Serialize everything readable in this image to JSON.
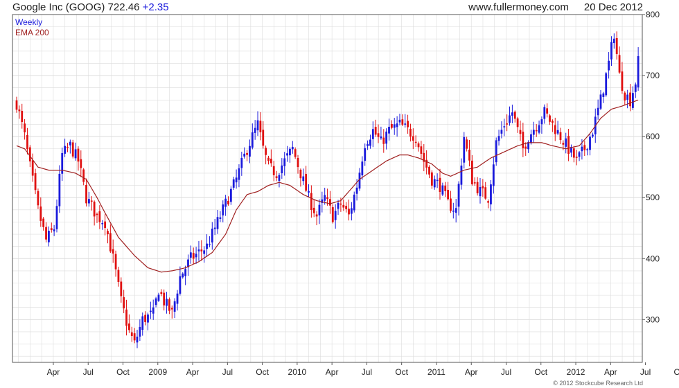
{
  "header": {
    "title": "Google Inc (GOOG) 722.46",
    "change": "+2.35",
    "website": "www.fullermoney.com",
    "date": "20 Dec 2012"
  },
  "legend": {
    "weekly": "Weekly",
    "ema": "EMA 200"
  },
  "copyright": "© 2012 Stockcube Research Ltd",
  "colors": {
    "up": "#1a1adc",
    "down": "#e01010",
    "ema": "#a02020",
    "grid": "#dcdcdc",
    "frame": "#555555"
  },
  "chart_data": {
    "type": "candlestick",
    "x_tick_labels": [
      "Apr",
      "Jul",
      "Oct",
      "2009",
      "Apr",
      "Jul",
      "Oct",
      "2010",
      "Apr",
      "Jul",
      "Oct",
      "2011",
      "Apr",
      "Jul",
      "Oct",
      "2012",
      "Apr",
      "Jul",
      "Oct"
    ],
    "y_tick_labels": [
      300,
      400,
      500,
      600,
      700,
      800
    ],
    "ylim": [
      230,
      800
    ],
    "grid": true,
    "legend_position": "top-left",
    "price_anchors": [
      [
        0,
        655
      ],
      [
        3,
        600
      ],
      [
        5,
        550
      ],
      [
        8,
        480
      ],
      [
        11,
        430
      ],
      [
        14,
        450
      ],
      [
        17,
        570
      ],
      [
        20,
        585
      ],
      [
        23,
        560
      ],
      [
        26,
        500
      ],
      [
        30,
        470
      ],
      [
        33,
        460
      ],
      [
        36,
        400
      ],
      [
        39,
        330
      ],
      [
        42,
        280
      ],
      [
        44,
        260
      ],
      [
        47,
        300
      ],
      [
        51,
        310
      ],
      [
        53,
        350
      ],
      [
        55,
        330
      ],
      [
        58,
        310
      ],
      [
        61,
        370
      ],
      [
        65,
        400
      ],
      [
        68,
        410
      ],
      [
        71,
        420
      ],
      [
        74,
        450
      ],
      [
        78,
        490
      ],
      [
        82,
        530
      ],
      [
        86,
        580
      ],
      [
        90,
        620
      ],
      [
        92,
        580
      ],
      [
        94,
        550
      ],
      [
        97,
        540
      ],
      [
        100,
        560
      ],
      [
        103,
        580
      ],
      [
        106,
        540
      ],
      [
        109,
        500
      ],
      [
        112,
        470
      ],
      [
        115,
        500
      ],
      [
        118,
        470
      ],
      [
        121,
        490
      ],
      [
        124,
        470
      ],
      [
        127,
        520
      ],
      [
        130,
        590
      ],
      [
        133,
        610
      ],
      [
        136,
        590
      ],
      [
        139,
        610
      ],
      [
        143,
        620
      ],
      [
        146,
        610
      ],
      [
        149,
        600
      ],
      [
        152,
        560
      ],
      [
        155,
        530
      ],
      [
        158,
        520
      ],
      [
        161,
        490
      ],
      [
        164,
        480
      ],
      [
        167,
        600
      ],
      [
        170,
        530
      ],
      [
        173,
        510
      ],
      [
        176,
        500
      ],
      [
        179,
        590
      ],
      [
        182,
        620
      ],
      [
        185,
        640
      ],
      [
        187,
        610
      ],
      [
        189,
        580
      ],
      [
        191,
        600
      ],
      [
        194,
        620
      ],
      [
        197,
        640
      ],
      [
        200,
        620
      ],
      [
        203,
        600
      ],
      [
        206,
        580
      ],
      [
        209,
        560
      ],
      [
        212,
        580
      ],
      [
        215,
        610
      ],
      [
        218,
        660
      ],
      [
        221,
        720
      ],
      [
        223,
        770
      ],
      [
        225,
        700
      ],
      [
        227,
        670
      ],
      [
        229,
        660
      ],
      [
        231,
        690
      ],
      [
        232,
        722.46
      ]
    ],
    "ema200_anchors": [
      [
        0,
        585
      ],
      [
        3,
        580
      ],
      [
        8,
        550
      ],
      [
        12,
        545
      ],
      [
        17,
        545
      ],
      [
        22,
        540
      ],
      [
        26,
        530
      ],
      [
        30,
        500
      ],
      [
        33,
        475
      ],
      [
        38,
        435
      ],
      [
        44,
        405
      ],
      [
        49,
        385
      ],
      [
        54,
        378
      ],
      [
        58,
        380
      ],
      [
        63,
        385
      ],
      [
        68,
        395
      ],
      [
        73,
        410
      ],
      [
        78,
        440
      ],
      [
        82,
        480
      ],
      [
        86,
        505
      ],
      [
        90,
        510
      ],
      [
        94,
        520
      ],
      [
        98,
        525
      ],
      [
        102,
        520
      ],
      [
        107,
        505
      ],
      [
        112,
        495
      ],
      [
        117,
        490
      ],
      [
        121,
        495
      ],
      [
        124,
        510
      ],
      [
        128,
        530
      ],
      [
        133,
        545
      ],
      [
        138,
        560
      ],
      [
        143,
        570
      ],
      [
        146,
        570
      ],
      [
        150,
        565
      ],
      [
        155,
        555
      ],
      [
        159,
        540
      ],
      [
        162,
        535
      ],
      [
        167,
        545
      ],
      [
        172,
        550
      ],
      [
        177,
        565
      ],
      [
        182,
        575
      ],
      [
        187,
        585
      ],
      [
        191,
        590
      ],
      [
        196,
        590
      ],
      [
        200,
        585
      ],
      [
        205,
        580
      ],
      [
        210,
        585
      ],
      [
        214,
        605
      ],
      [
        218,
        630
      ],
      [
        222,
        645
      ],
      [
        226,
        650
      ],
      [
        229,
        655
      ],
      [
        232,
        660
      ]
    ]
  }
}
